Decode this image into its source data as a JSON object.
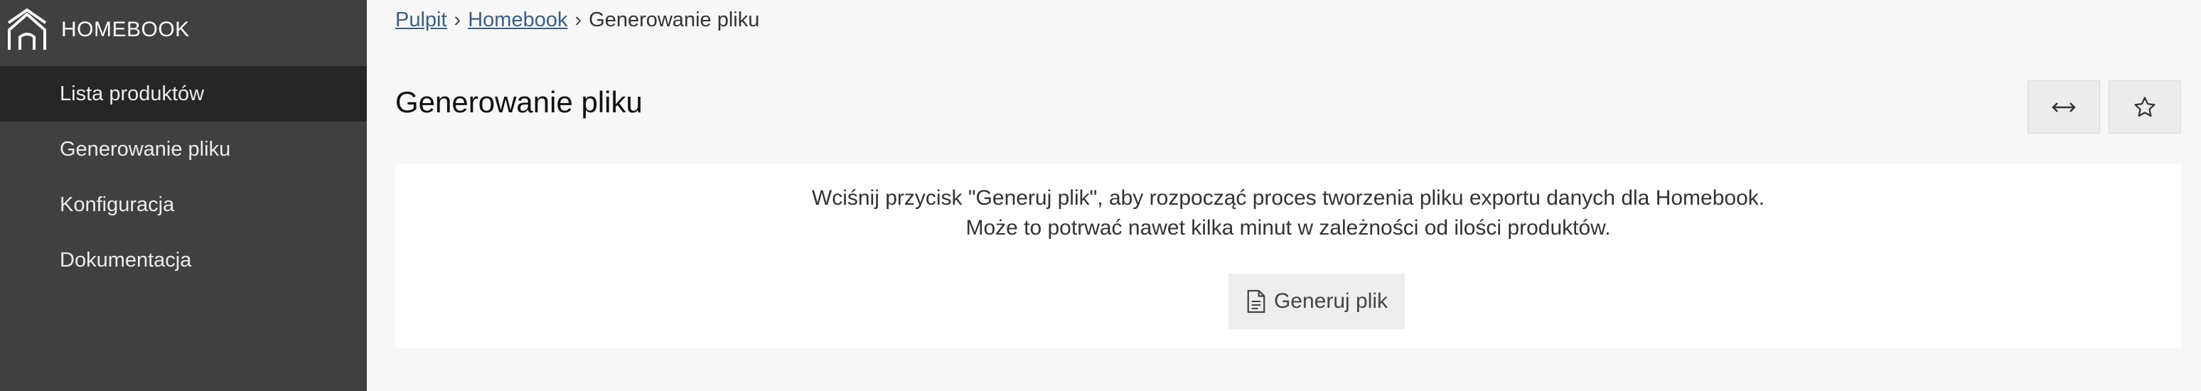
{
  "app": {
    "name": "HOMEBOOK",
    "logo_icon": "house-icon"
  },
  "sidebar": {
    "items": [
      {
        "label": "Lista produktów",
        "active": true
      },
      {
        "label": "Generowanie pliku",
        "active": false
      },
      {
        "label": "Konfiguracja",
        "active": false
      },
      {
        "label": "Dokumentacja",
        "active": false
      }
    ]
  },
  "breadcrumb": {
    "items": [
      {
        "label": "Pulpit",
        "link": true
      },
      {
        "label": "Homebook",
        "link": true
      },
      {
        "label": "Generowanie pliku",
        "link": false
      }
    ],
    "separator": "›"
  },
  "page": {
    "title": "Generowanie pliku",
    "actions": [
      {
        "icon": "expand-horizontal-icon"
      },
      {
        "icon": "star-icon"
      }
    ]
  },
  "panel": {
    "line1": "Wciśnij przycisk \"Generuj plik\", aby rozpocząć proces tworzenia pliku exportu danych dla Homebook.",
    "line2": "Może to potrwać nawet kilka minut w zależności od ilości produktów.",
    "button_label": "Generuj plik",
    "button_icon": "file-icon"
  },
  "colors": {
    "sidebar_bg": "#404040",
    "sidebar_active_bg": "#262626",
    "page_bg": "#f7f7f7",
    "link": "#3d5f85"
  }
}
